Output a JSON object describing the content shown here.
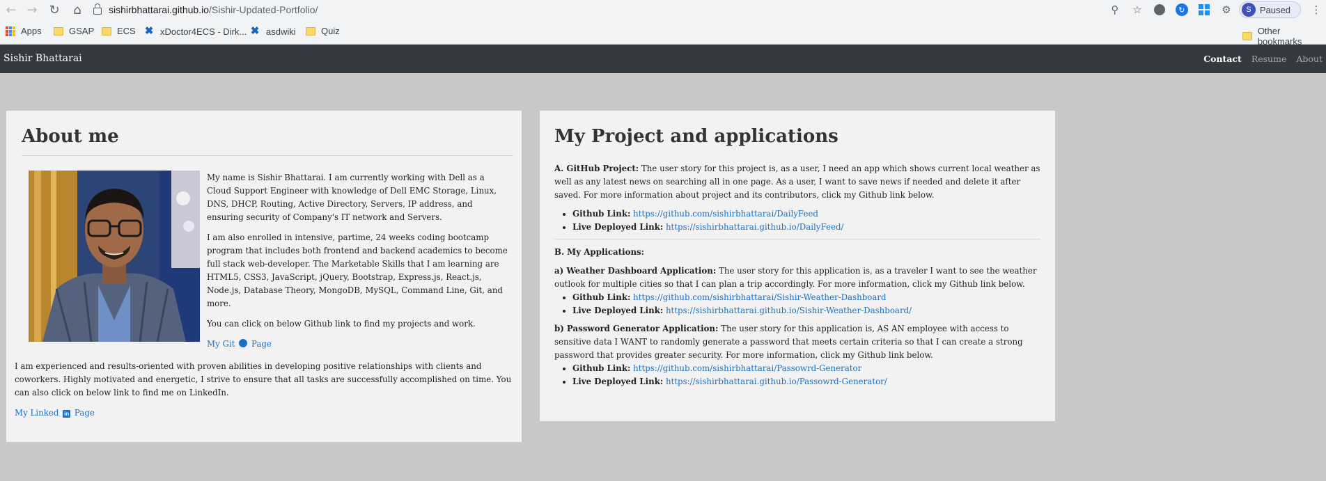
{
  "browser": {
    "url_host": "sishirbhattarai.github.io",
    "url_path": "/Sishir-Updated-Portfolio/",
    "profile_initial": "S",
    "profile_status": "Paused",
    "icons": [
      "back-icon",
      "forward-icon",
      "reload-icon",
      "home-icon",
      "zoom-icon",
      "star-icon",
      "extension-icon",
      "puzzle-icon"
    ]
  },
  "bookmarks": {
    "items": [
      "Apps",
      "GSAP",
      "ECS",
      "xDoctor4ECS - Dirk...",
      "asdwiki",
      "Quiz"
    ],
    "other": "Other bookmarks"
  },
  "navbar": {
    "brand": "Sishir Bhattarai",
    "links": [
      "Contact",
      "Resume",
      "About"
    ]
  },
  "about": {
    "title": "About me",
    "p1": "My name is Sishir Bhattarai. I am currently working with Dell as a Cloud Support Engineer with knowledge of Dell EMC Storage, Linux, DNS, DHCP, Routing, Active Directory, Servers, IP address, and ensuring security of Company's IT network and Servers.",
    "p2": "I am also enrolled in intensive, partime, 24 weeks coding bootcamp program that includes both frontend and backend academics to become full stack web-developer. The Marketable Skills that I am learning are HTML5, CSS3, JavaScript, jQuery, Bootstrap, Express.js, React.js, Node.js, Database Theory, MongoDB, MySQL, Command Line, Git, and more.",
    "p3": "You can click on below Github link to find my projects and work.",
    "git_link_pre": "My Git",
    "git_link_post": "Page",
    "p4": "I am experienced and results-oriented with proven abilities in developing positive relationships with clients and coworkers. Highly motivated and energetic, I strive to ensure that all tasks are successfully accomplished on time. You can also click on below link to find me on LinkedIn.",
    "linkedin_pre": "My Linked",
    "linkedin_icon": "in",
    "linkedin_post": "Page"
  },
  "projects": {
    "title": "My Project and applications",
    "a_label": "A. GitHub Project:",
    "a_text": "The user story for this project is, as a user, I need an app which shows current local weather as well as any latest news on searching all in one page. As a user, I want to save news if needed and delete it after saved. For more information about project and its contributors, click my Github link below.",
    "github_label": "Github Link:",
    "live_label": "Live Deployed Link:",
    "a_github": "https://github.com/sishirbhattarai/DailyFeed",
    "a_live": "https://sishirbhattarai.github.io/DailyFeed/",
    "b_label": "B. My Applications:",
    "wa_label": "a) Weather Dashboard Application:",
    "wa_text": "The user story for this application is, as a traveler I want to see the weather outlook for multiple cities so that I can plan a trip accordingly. For more information, click my Github link below.",
    "wa_github": "https://github.com/sishirbhattarai/Sishir-Weather-Dashboard",
    "wa_live": "https://sishirbhattarai.github.io/Sishir-Weather-Dashboard/",
    "pg_label": "b) Password Generator Application:",
    "pg_text": "The user story for this application is, AS AN employee with access to sensitive data I WANT to randomly generate a password that meets certain criteria so that I can create a strong password that provides greater security. For more information, click my Github link below.",
    "pg_github": "https://github.com/sishirbhattarai/Passowrd-Generator",
    "pg_live": "https://sishirbhattarai.github.io/Passowrd-Generator/"
  }
}
